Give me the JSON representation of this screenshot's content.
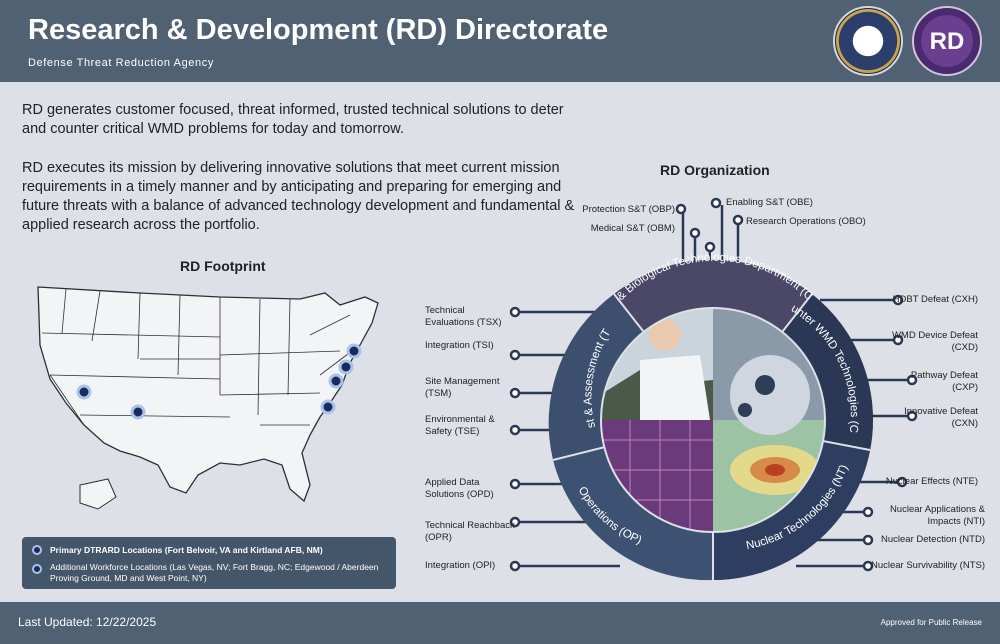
{
  "header": {
    "title": "Research & Development (RD) Directorate",
    "subtitle": "Defense Threat Reduction Agency",
    "rd_logo_text": "RD"
  },
  "intro": {
    "paragraph1": "RD generates customer focused, threat informed, trusted technical solutions to deter and counter critical WMD problems for today and tomorrow.",
    "paragraph2": "RD executes its mission by delivering innovative solutions that meet current mission requirements in a timely manner and by anticipating and preparing for emerging and future threats with a balance of advanced technology development and fundamental & applied research across the portfolio."
  },
  "footprint": {
    "title": "RD Footprint",
    "legend": {
      "primary": "Primary DTRARD Locations (Fort Belvoir, VA and Kirtland AFB, NM)",
      "additional": "Additional Workforce Locations (Las Vegas, NV; Fort Bragg, NC; Edgewood / Aberdeen Proving Ground, MD and West Point, NY)"
    }
  },
  "organization": {
    "title": "RD Organization",
    "departments": {
      "cb": "Chemical & Biological Technologies Department (CB) (JSTO)",
      "cx": "Counter WMD Technologies (CX)",
      "nt": "Nuclear Technologies (NT)",
      "op": "Operations (OP)",
      "ts": "Test & Assessment (TS)"
    },
    "cb_divisions": {
      "obp": "Protection S&T (OBP)",
      "obm": "Medical S&T (OBM)",
      "obe": "Enabling S&T (OBE)",
      "obo": "Research Operations (OBO)"
    },
    "ts_divisions": {
      "tsx": "Technical Evaluations (TSX)",
      "tsi": "Integration (TSI)",
      "tsm": "Site Management (TSM)",
      "tse": "Environmental & Safety (TSE)"
    },
    "op_divisions": {
      "opd": "Applied Data Solutions (OPD)",
      "opr": "Technical Reachback (OPR)",
      "opi": "Integration (OPI)"
    },
    "cx_divisions": {
      "cxh": "HDBT Defeat (CXH)",
      "cxd": "WMD Device Defeat (CXD)",
      "cxp": "Pathway Defeat (CXP)",
      "cxn": "Innovative Defeat (CXN)"
    },
    "nt_divisions": {
      "nte": "Nuclear Effects (NTE)",
      "nti": "Nuclear Applications & Impacts (NTI)",
      "ntd": "Nuclear Detection (NTD)",
      "nts": "Nuclear Survivability (NTS)"
    }
  },
  "footer": {
    "last_updated": "Last Updated: 12/22/2025",
    "approved": "Approved for Public Release"
  },
  "colors": {
    "header_bg": "#4f6173",
    "ring_dark": "#2a3856",
    "ring_mid": "#3d4f6e",
    "ring_purple": "#4b4766",
    "ring_light": "#5a6c8c",
    "connector": "#2a3856"
  }
}
